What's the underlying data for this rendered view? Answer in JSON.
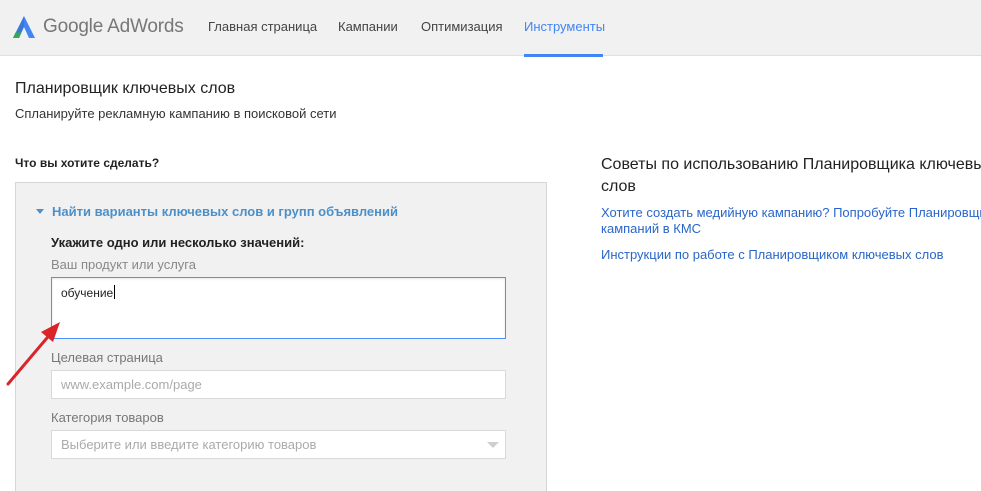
{
  "brand": {
    "google": "Google",
    "adwords": "AdWords",
    "logo_color": "#4285f4"
  },
  "nav": {
    "items": [
      {
        "label": "Главная страница",
        "active": false
      },
      {
        "label": "Кампании",
        "active": false
      },
      {
        "label": "Оптимизация",
        "active": false
      },
      {
        "label": "Инструменты",
        "active": true
      }
    ],
    "active_color": "#4285f4"
  },
  "page": {
    "title": "Планировщик ключевых слов",
    "subtitle": "Спланируйте рекламную кампанию в поисковой сети"
  },
  "form": {
    "question": "Что вы хотите сделать?",
    "section_title": "Найти варианты ключевых слов и групп объявлений",
    "section_icon": "triangle-down-icon",
    "required_label": "Укажите одно или несколько значений:",
    "product_label": "Ваш продукт или услуга",
    "product_value": "обучение",
    "landing_label": "Целевая страница",
    "landing_placeholder": "www.example.com/page",
    "category_label": "Категория товаров",
    "category_placeholder": "Выберите или введите категорию товаров",
    "category_icon": "chevron-down-icon"
  },
  "tips": {
    "title_line1": "Советы по использованию Планировщика ключевы",
    "title_line2": "слов",
    "link1_line1": "Хотите создать медийную кампанию? Попробуйте Планировщи",
    "link1_line2": "кампаний в КМС",
    "link2": "Инструкции по работе с Планировщиком ключевых слов"
  },
  "annotation": {
    "arrow_color": "#d9252a",
    "icon": "red-arrow-icon"
  }
}
